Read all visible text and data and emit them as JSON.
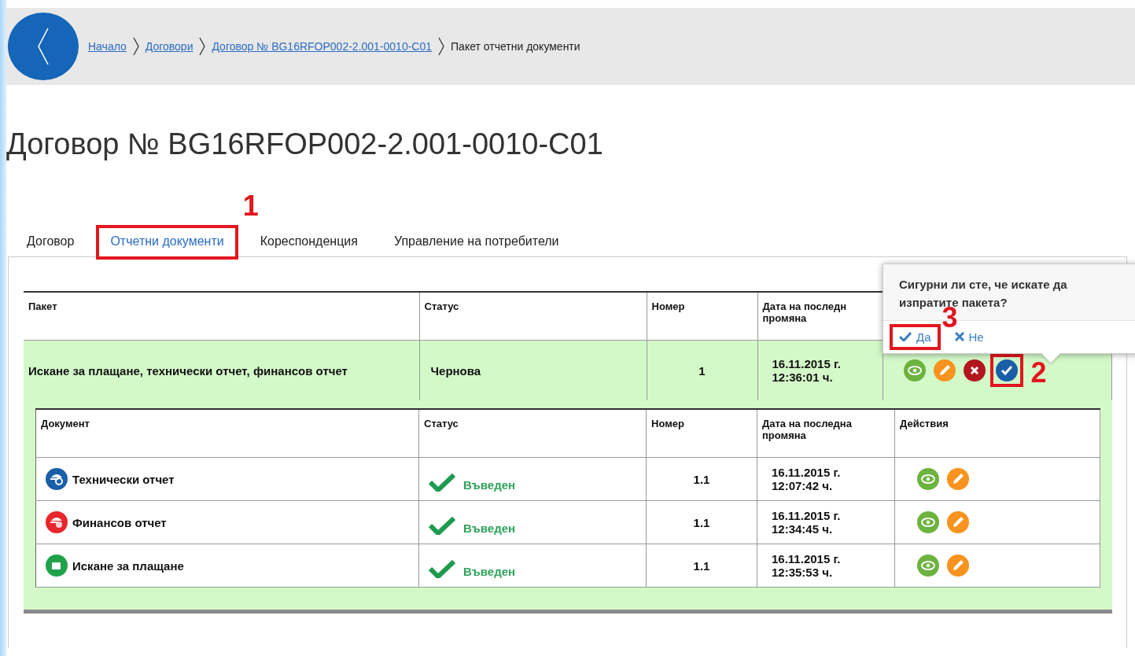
{
  "breadcrumbs": [
    {
      "label": "Начало",
      "link": true
    },
    {
      "label": "Договори",
      "link": true
    },
    {
      "label": "Договор № BG16RFOP002-2.001-0010-C01",
      "link": true
    },
    {
      "label": "Пакет отчетни документи",
      "link": false
    }
  ],
  "title": "Договор № BG16RFOP002-2.001-0010-C01",
  "tabs": [
    {
      "label": "Договор",
      "selected": false
    },
    {
      "label": "Отчетни документи",
      "selected": true,
      "callout": "1"
    },
    {
      "label": "Кореспонденция",
      "selected": false
    },
    {
      "label": "Управление на потребители",
      "selected": false
    }
  ],
  "packages_table": {
    "columns": [
      {
        "lines": [
          "Пакет"
        ]
      },
      {
        "lines": [
          "Статус"
        ]
      },
      {
        "lines": [
          "Номер"
        ]
      },
      {
        "lines": [
          "Дата на последн",
          "промяна"
        ]
      }
    ],
    "rows": [
      {
        "package": "Искане за плащане, технически отчет, финансов отчет",
        "status": "Чернова",
        "number": "1",
        "date": "16.11.2015 г.",
        "time": "12:36:01 ч.",
        "actions": [
          {
            "kind": "view"
          },
          {
            "kind": "edit"
          },
          {
            "kind": "delete"
          },
          {
            "kind": "send",
            "callout": "2"
          }
        ]
      }
    ]
  },
  "documents_table": {
    "columns": [
      {
        "lines": [
          "Документ"
        ]
      },
      {
        "lines": [
          "Статус"
        ]
      },
      {
        "lines": [
          "Номер"
        ]
      },
      {
        "lines": [
          "Дата на последна",
          "промяна"
        ]
      },
      {
        "lines": [
          "Действия"
        ]
      }
    ],
    "rows": [
      {
        "kind": "technical",
        "document": "Технически отчет",
        "status": "Въведен",
        "number": "1.1",
        "date": "16.11.2015 г.",
        "time": "12:07:42 ч.",
        "actions": [
          {
            "kind": "view"
          },
          {
            "kind": "edit"
          }
        ]
      },
      {
        "kind": "financial",
        "document": "Финансов отчет",
        "status": "Въведен",
        "number": "1.1",
        "date": "16.11.2015 г.",
        "time": "12:34:45 ч.",
        "actions": [
          {
            "kind": "view"
          },
          {
            "kind": "edit"
          }
        ]
      },
      {
        "kind": "payment",
        "document": "Искане за плащане",
        "status": "Въведен",
        "number": "1.1",
        "date": "16.11.2015 г.",
        "time": "12:35:53 ч.",
        "actions": [
          {
            "kind": "view"
          },
          {
            "kind": "edit"
          }
        ]
      }
    ]
  },
  "popover": {
    "question": "Сигурни ли сте, че искате да изпратите пакета?",
    "buttons": [
      {
        "kind": "confirm",
        "label": "Да",
        "callout": "3"
      },
      {
        "kind": "cancel",
        "label": "Не"
      }
    ]
  }
}
